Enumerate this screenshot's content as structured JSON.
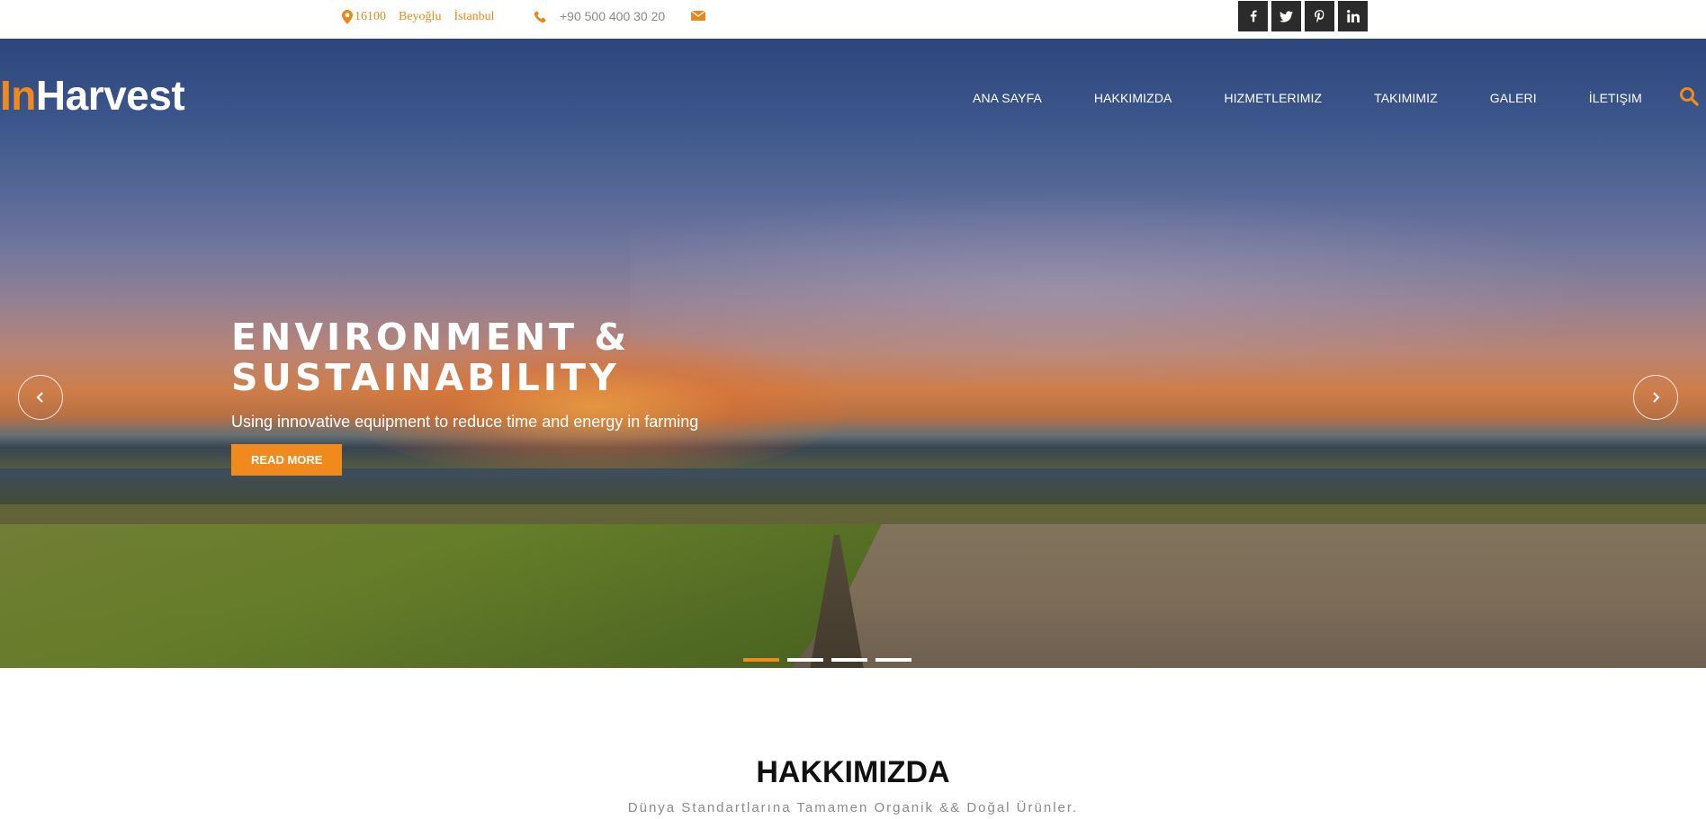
{
  "topbar": {
    "address": [
      "16100",
      "Beyoğlu",
      "İstanbul"
    ],
    "phone": "+90 500 400 30 20",
    "icons": [
      "map-marker-icon",
      "phone-icon",
      "envelope-icon"
    ],
    "socials": [
      {
        "name": "facebook-icon",
        "glyph": "f"
      },
      {
        "name": "twitter-icon",
        "glyph": "t"
      },
      {
        "name": "pinterest-icon",
        "glyph": "p"
      },
      {
        "name": "linkedin-icon",
        "glyph": "in"
      }
    ]
  },
  "logo": {
    "accent": "In",
    "rest": "Harvest"
  },
  "nav": [
    "ANA SAYFA",
    "HAKKIMIZDA",
    "HIZMETLERIMIZ",
    "TAKIMIMIZ",
    "GALERI",
    "İLETIŞIM"
  ],
  "slider": {
    "title_line1": "ENVIRONMENT &",
    "title_line2": "SUSTAINABILITY",
    "subtitle": "Using innovative equipment to reduce time and energy in farming",
    "button": "READ MORE",
    "slide_count": 4,
    "active_slide": 1
  },
  "about": {
    "title": "HAKKIMIZDA",
    "subtitle": "Dünya Standartlarına Tamamen Organik && Doğal Ürünler."
  },
  "colors": {
    "accent": "#f08a1c",
    "dark": "#2b2b2b",
    "muted": "#8a8a8a"
  }
}
